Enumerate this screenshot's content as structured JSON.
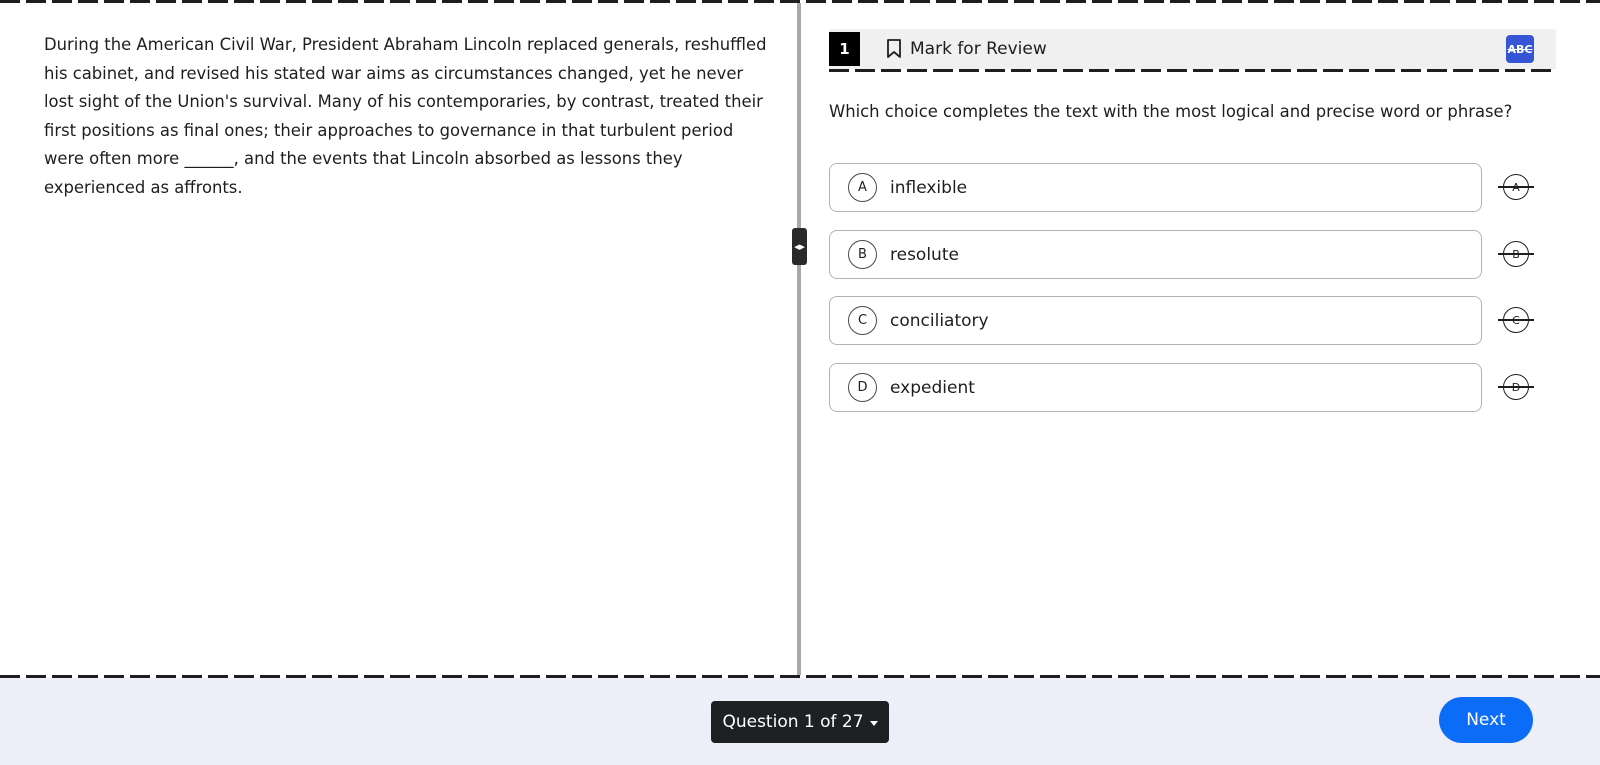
{
  "passage": {
    "text": "During the American Civil War, President Abraham Lincoln replaced generals, reshuffled his cabinet, and revised his stated war aims as circumstances changed, yet he never lost sight of the Union's survival. Many of his contemporaries, by contrast, treated their first positions as final ones; their approaches to governance in that turbulent period were often more ______, and the events that Lincoln absorbed as lessons they experienced as affronts."
  },
  "question": {
    "number": "1",
    "mark_label": "Mark for Review",
    "abc_label": "ABC",
    "prompt": "Which choice completes the text with the most logical and precise word or phrase?",
    "choices": [
      {
        "letter": "A",
        "text": "inflexible"
      },
      {
        "letter": "B",
        "text": "resolute"
      },
      {
        "letter": "C",
        "text": "conciliatory"
      },
      {
        "letter": "D",
        "text": "expedient"
      }
    ]
  },
  "footer": {
    "nav_label": "Question 1 of 27",
    "next_label": "Next"
  },
  "colors": {
    "accent_blue": "#0b6cf8",
    "abc_blue": "#3655d4",
    "footer_bg": "#eeeef8",
    "nav_dark": "#1e2124"
  },
  "icons": {
    "bookmark": "bookmark-icon",
    "caret": "caret-down-icon",
    "resize": "resize-handle-icon"
  }
}
